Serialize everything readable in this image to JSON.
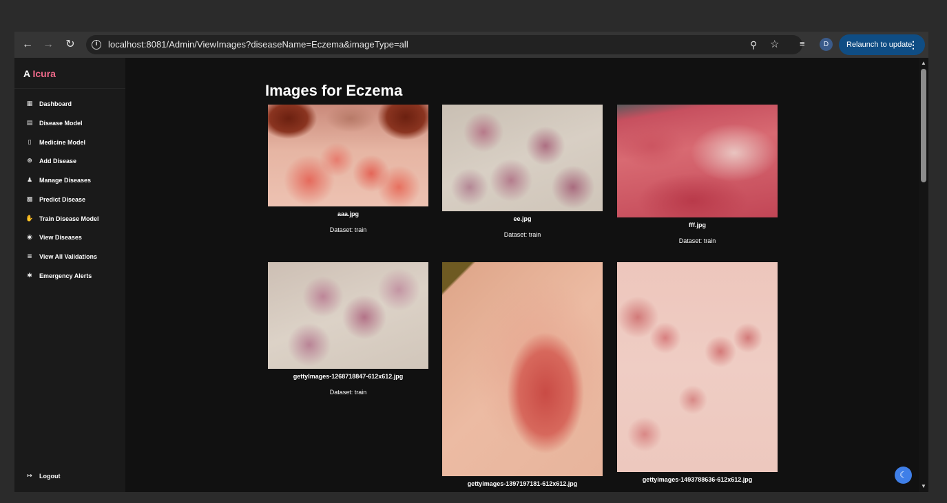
{
  "browser": {
    "url": "localhost:8081/Admin/ViewImages?diseaseName=Eczema&imageType=all",
    "relaunch_label": "Relaunch to update",
    "profile_initial": "D",
    "icons": [
      "back-icon",
      "forward-icon",
      "reload-icon",
      "info-icon",
      "zoom-icon",
      "star-icon",
      "media-icon",
      "more-vert-icon"
    ]
  },
  "sidebar": {
    "brand_prefix": "A",
    "brand_name": "Icura",
    "items": [
      {
        "label": "Dashboard",
        "icon": "dashboard-icon"
      },
      {
        "label": "Disease Model",
        "icon": "table-icon"
      },
      {
        "label": "Medicine Model",
        "icon": "medicine-icon"
      },
      {
        "label": "Add Disease",
        "icon": "plus-circle-icon"
      },
      {
        "label": "Manage Diseases",
        "icon": "people-icon"
      },
      {
        "label": "Predict Disease",
        "icon": "clipboard-icon"
      },
      {
        "label": "Train Disease Model",
        "icon": "hand-icon"
      },
      {
        "label": "View Diseases",
        "icon": "eye-icon"
      },
      {
        "label": "View All Validations",
        "icon": "list-check-icon"
      },
      {
        "label": "Emergency Alerts",
        "icon": "asterisk-icon"
      }
    ],
    "logout_label": "Logout"
  },
  "main": {
    "title": "Images for Eczema",
    "images": [
      {
        "name": "aaa.jpg",
        "dataset": "Dataset: train"
      },
      {
        "name": "ee.jpg",
        "dataset": "Dataset: train"
      },
      {
        "name": "fff.jpg",
        "dataset": "Dataset: train"
      },
      {
        "name": "gettyImages-1268718847-612x612.jpg",
        "dataset": "Dataset: train"
      },
      {
        "name": "gettyimages-1397197181-612x612.jpg",
        "dataset": ""
      },
      {
        "name": "gettyimages-1493788636-612x612.jpg",
        "dataset": ""
      }
    ]
  },
  "colors": {
    "accent": "#f06a8a",
    "relaunch_bg": "#0f4d84",
    "theme_button": "#3f7fe8"
  }
}
